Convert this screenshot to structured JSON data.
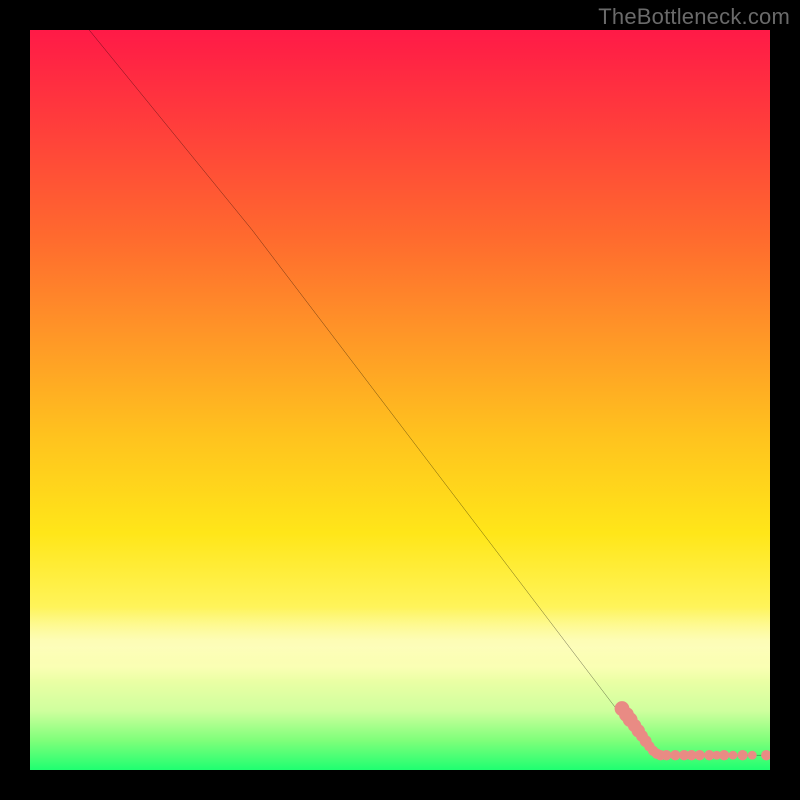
{
  "attribution": "TheBottleneck.com",
  "colors": {
    "dot_fill": "#e98b84",
    "line": "#000000"
  },
  "chart_data": {
    "type": "line",
    "title": "",
    "xlabel": "",
    "ylabel": "",
    "xlim": [
      0,
      100
    ],
    "ylim": [
      0,
      100
    ],
    "grid": false,
    "legend": false,
    "line_points": [
      {
        "x": 8,
        "y": 100
      },
      {
        "x": 30,
        "y": 73
      },
      {
        "x": 84,
        "y": 2
      },
      {
        "x": 100,
        "y": 2
      }
    ],
    "notes": "x is percent across plot width (0=left), y is percent (0=bottom, 100=top). Values estimated from pixels; chart has no visible axis ticks.",
    "dot_segments": [
      {
        "along_line": true,
        "start_x": 80,
        "end_x": 85,
        "count": 12
      },
      {
        "along_line": false,
        "y": 2,
        "start_x": 85,
        "end_x": 100,
        "count": 14
      }
    ],
    "dots": [
      {
        "x": 80.0,
        "y": 8.3,
        "r": 1.0
      },
      {
        "x": 80.6,
        "y": 7.5,
        "r": 1.0
      },
      {
        "x": 81.1,
        "y": 6.8,
        "r": 1.0
      },
      {
        "x": 81.7,
        "y": 6.0,
        "r": 0.9
      },
      {
        "x": 82.2,
        "y": 5.3,
        "r": 0.9
      },
      {
        "x": 82.7,
        "y": 4.6,
        "r": 0.8
      },
      {
        "x": 83.2,
        "y": 3.9,
        "r": 0.8
      },
      {
        "x": 83.7,
        "y": 3.2,
        "r": 0.7
      },
      {
        "x": 84.2,
        "y": 2.6,
        "r": 0.7
      },
      {
        "x": 84.7,
        "y": 2.2,
        "r": 0.7
      },
      {
        "x": 85.2,
        "y": 2.0,
        "r": 0.7
      },
      {
        "x": 86.0,
        "y": 2.0,
        "r": 0.7
      },
      {
        "x": 87.2,
        "y": 2.0,
        "r": 0.7
      },
      {
        "x": 88.4,
        "y": 2.0,
        "r": 0.7
      },
      {
        "x": 89.4,
        "y": 2.0,
        "r": 0.7
      },
      {
        "x": 90.5,
        "y": 2.0,
        "r": 0.7
      },
      {
        "x": 91.8,
        "y": 2.0,
        "r": 0.7
      },
      {
        "x": 92.8,
        "y": 2.0,
        "r": 0.6
      },
      {
        "x": 93.8,
        "y": 2.0,
        "r": 0.7
      },
      {
        "x": 95.0,
        "y": 2.0,
        "r": 0.6
      },
      {
        "x": 96.3,
        "y": 2.0,
        "r": 0.7
      },
      {
        "x": 97.6,
        "y": 2.0,
        "r": 0.6
      },
      {
        "x": 99.5,
        "y": 2.0,
        "r": 0.7
      }
    ]
  }
}
